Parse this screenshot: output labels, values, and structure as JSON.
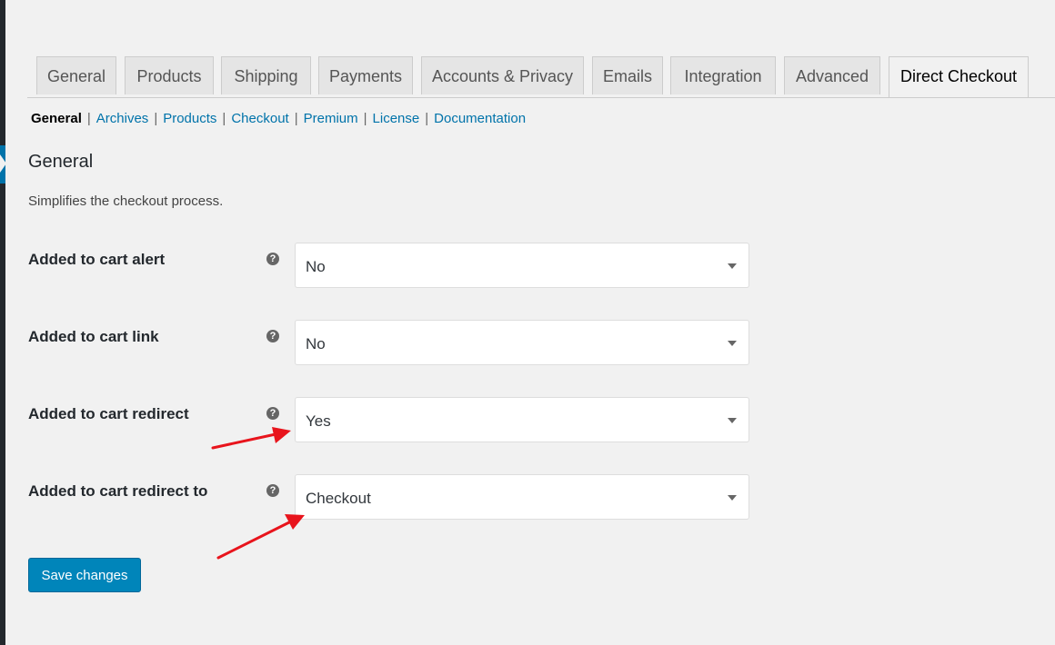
{
  "tabs": [
    {
      "label": "General"
    },
    {
      "label": "Products"
    },
    {
      "label": "Shipping"
    },
    {
      "label": "Payments"
    },
    {
      "label": "Accounts & Privacy"
    },
    {
      "label": "Emails"
    },
    {
      "label": "Integration"
    },
    {
      "label": "Advanced"
    },
    {
      "label": "Direct Checkout",
      "active": true
    }
  ],
  "subnav": {
    "current": "General",
    "links": [
      "Archives",
      "Products",
      "Checkout",
      "Premium",
      "License",
      "Documentation"
    ],
    "separator": "|"
  },
  "section": {
    "title": "General",
    "description": "Simplifies the checkout process."
  },
  "help_icon_glyph": "?",
  "fields": [
    {
      "label": "Added to cart alert",
      "value": "No"
    },
    {
      "label": "Added to cart link",
      "value": "No"
    },
    {
      "label": "Added to cart redirect",
      "value": "Yes"
    },
    {
      "label": "Added to cart redirect to",
      "value": "Checkout"
    }
  ],
  "save_button": {
    "label": "Save changes"
  },
  "colors": {
    "accent": "#0073aa",
    "button": "#0085ba",
    "annotation_arrow": "#e8141c"
  }
}
